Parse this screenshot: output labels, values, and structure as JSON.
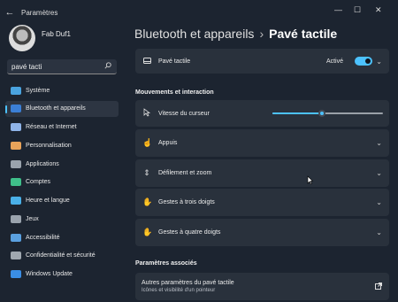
{
  "window": {
    "title": "Paramètres",
    "back_glyph": "←",
    "min_glyph": "—",
    "max_glyph": "☐",
    "close_glyph": "✕"
  },
  "user": {
    "name": "Fab Duf1"
  },
  "search": {
    "value": "pavé tacti"
  },
  "nav": {
    "items": [
      {
        "label": "Système",
        "color": "#4aa3df"
      },
      {
        "label": "Bluetooth et appareils",
        "color": "#3b7fd6"
      },
      {
        "label": "Réseau et Internet",
        "color": "#8fb4e8"
      },
      {
        "label": "Personnalisation",
        "color": "#e8a35a"
      },
      {
        "label": "Applications",
        "color": "#9aa3ad"
      },
      {
        "label": "Comptes",
        "color": "#3fbf8a"
      },
      {
        "label": "Heure et langue",
        "color": "#4ab0e8"
      },
      {
        "label": "Jeux",
        "color": "#9aa3ad"
      },
      {
        "label": "Accessibilité",
        "color": "#5aa0e0"
      },
      {
        "label": "Confidentialité et sécurité",
        "color": "#a0a8b0"
      },
      {
        "label": "Windows Update",
        "color": "#3a8ee6"
      }
    ],
    "active_index": 1
  },
  "breadcrumb": {
    "parent": "Bluetooth et appareils",
    "separator": "›",
    "current": "Pavé tactile"
  },
  "touchpad_card": {
    "label": "Pavé tactile",
    "status": "Activé",
    "toggle_on": true
  },
  "section_interaction": "Mouvements et interaction",
  "cursor_speed": {
    "label": "Vitesse du curseur",
    "value": 0.45
  },
  "cards": {
    "taps": "Appuis",
    "scroll": "Défilement et zoom",
    "three_finger": "Gestes à trois doigts",
    "four_finger": "Gestes à quatre doigts"
  },
  "section_related": "Paramètres associés",
  "related": {
    "title": "Autres paramètres du pavé tactile",
    "subtitle": "Icônes et visibilité d'un pointeur"
  }
}
